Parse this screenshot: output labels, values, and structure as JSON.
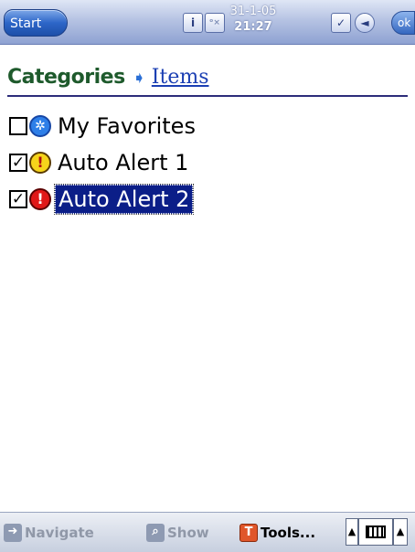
{
  "topbar": {
    "start_label": "Start",
    "info_icon": "i",
    "volume_icon": "ᵒ×",
    "date": "31-1-05",
    "time": "21:27",
    "tasks_icon": "✓",
    "back_icon": "◄",
    "ok_label": "ok"
  },
  "breadcrumb": {
    "categories": "Categories",
    "arrow": "➧",
    "items": "Items"
  },
  "list": {
    "items": [
      {
        "label": "My Favorites",
        "checked": "",
        "icon": "✲",
        "icon_name": "favorites-icon"
      },
      {
        "label": "Auto Alert 1",
        "checked": "✓",
        "icon": "!",
        "icon_name": "alert-yellow-icon"
      },
      {
        "label": "Auto Alert 2",
        "checked": "✓",
        "icon": "!",
        "icon_name": "alert-red-icon",
        "selected": true
      }
    ]
  },
  "bottombar": {
    "navigate_label": "Navigate",
    "navigate_icon": "➜",
    "show_label": "Show",
    "show_icon": "⌕",
    "tools_label": "Tools...",
    "tools_icon": "T",
    "sip_up": "▲",
    "sip_menu": "▲"
  },
  "colors": {
    "selection": "#0b1e88",
    "crumb_categories": "#1e5a2c",
    "crumb_items": "#1b3fb3"
  }
}
